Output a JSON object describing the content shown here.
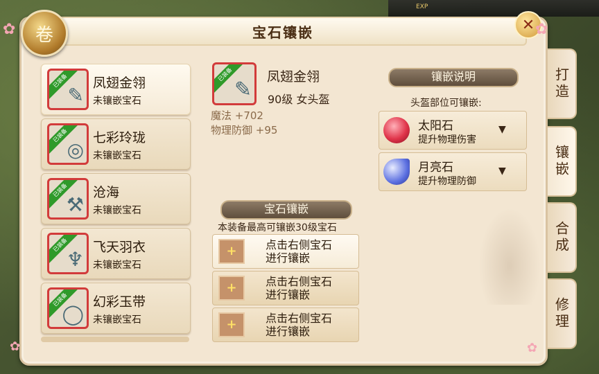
{
  "window": {
    "title": "宝石镶嵌",
    "close_symbol": "✕",
    "emblem_symbol": "卷",
    "exp_label": "EXP"
  },
  "equipment_list": [
    {
      "badge": "已装备",
      "name": "凤翅金翎",
      "status": "未镶嵌宝石",
      "icon": "feather-helmet-icon",
      "glyph": "✎"
    },
    {
      "badge": "已装备",
      "name": "七彩玲珑",
      "status": "未镶嵌宝石",
      "icon": "necklace-icon",
      "glyph": "◎"
    },
    {
      "badge": "已装备",
      "name": "沧海",
      "status": "未镶嵌宝石",
      "icon": "hammer-weapon-icon",
      "glyph": "⚒"
    },
    {
      "badge": "已装备",
      "name": "飞天羽衣",
      "status": "未镶嵌宝石",
      "icon": "robe-armor-icon",
      "glyph": "♆"
    },
    {
      "badge": "已装备",
      "name": "幻彩玉带",
      "status": "未镶嵌宝石",
      "icon": "jade-belt-icon",
      "glyph": "◯"
    }
  ],
  "selected_item": {
    "badge": "已装备",
    "name": "凤翅金翎",
    "level_type": "90级  女头盔",
    "stats": [
      "魔法  +702",
      "物理防御  +95"
    ]
  },
  "inlay_section": {
    "banner": "宝石镶嵌",
    "note": "本装备最高可镶嵌30级宝石",
    "slots": [
      {
        "plus": "+",
        "line1": "点击右侧宝石",
        "line2": "进行镶嵌"
      },
      {
        "plus": "+",
        "line1": "点击右侧宝石",
        "line2": "进行镶嵌"
      },
      {
        "plus": "+",
        "line1": "点击右侧宝石",
        "line2": "进行镶嵌"
      }
    ]
  },
  "inlay_help": {
    "banner": "镶嵌说明",
    "note": "头盔部位可镶嵌:",
    "gems": [
      {
        "name": "太阳石",
        "desc": "提升物理伤害",
        "arrow": "▼",
        "icon": "sun-stone-icon",
        "color": "#e0344a"
      },
      {
        "name": "月亮石",
        "desc": "提升物理防御",
        "arrow": "▼",
        "icon": "moon-stone-icon",
        "color": "#5b6fe0"
      }
    ]
  },
  "side_tabs": [
    {
      "label": "打造",
      "active": false
    },
    {
      "label": "镶嵌",
      "active": true
    },
    {
      "label": "合成",
      "active": false
    },
    {
      "label": "修理",
      "active": false
    }
  ]
}
